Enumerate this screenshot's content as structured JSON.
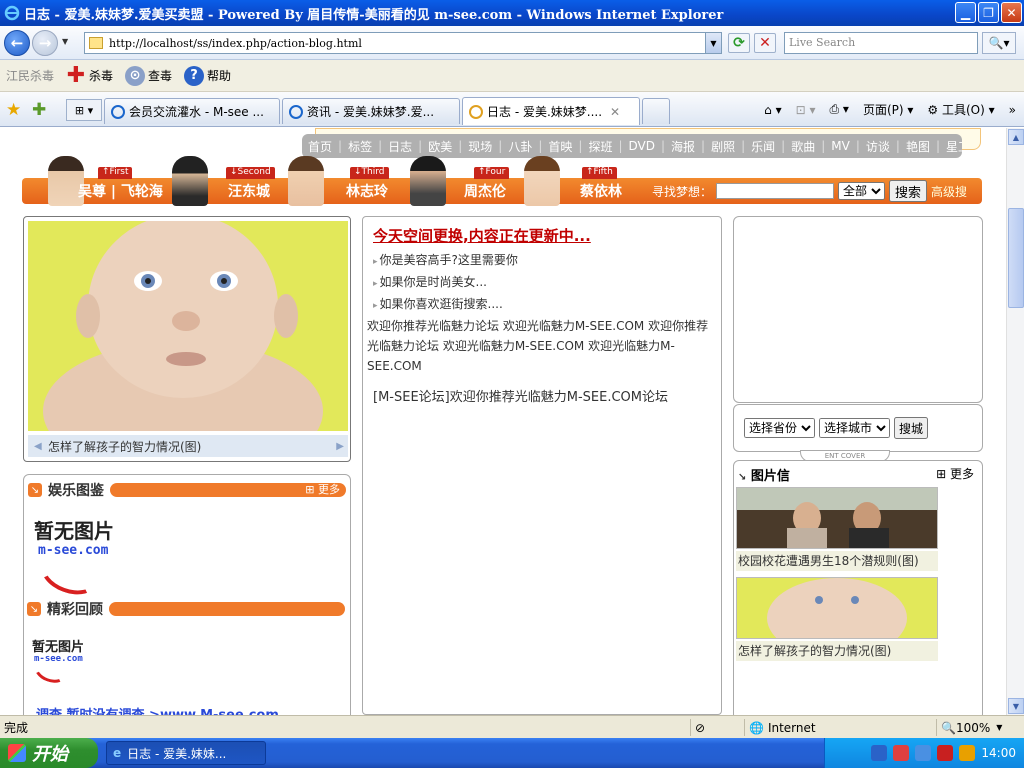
{
  "window": {
    "title": "日志 - 爱美.妹妹梦.爱美买卖盟 - Powered By 眉目传情-美丽看的见 m-see.com - Windows Internet Explorer"
  },
  "address_bar": {
    "url": "http://localhost/ss/index.php/action-blog.html",
    "search_placeholder": "Live Search"
  },
  "personal_toolbar": {
    "brand": "江民杀毒",
    "items": [
      "杀毒",
      "查毒",
      "帮助"
    ]
  },
  "tabs": [
    {
      "label": "会员交流灌水 - M-see ...",
      "active": false
    },
    {
      "label": "资讯 - 爱美.妹妹梦.爱...",
      "active": false
    },
    {
      "label": "日志 - 爱美.妹妹梦....",
      "active": true
    }
  ],
  "ie_tools": {
    "page": "页面(P)",
    "tools": "工具(O)"
  },
  "site": {
    "top_nav": [
      "首页",
      "标签",
      "日志",
      "欧美",
      "现场",
      "八卦",
      "首映",
      "探班",
      "DVD",
      "海报",
      "剧照",
      "乐闻",
      "歌曲",
      "MV",
      "访谈",
      "艳图",
      "星工场"
    ],
    "stars": [
      {
        "tag": "↑First",
        "name": "吴尊 | 飞轮海"
      },
      {
        "tag": "↓Second",
        "name": "汪东城"
      },
      {
        "tag": "↓Third",
        "name": "林志玲"
      },
      {
        "tag": "↑Four",
        "name": "周杰伦"
      },
      {
        "tag": "↑Fifth",
        "name": "蔡依林"
      }
    ],
    "search": {
      "label": "寻找梦想：",
      "select": "全部",
      "button": "搜索",
      "advanced": "高级搜"
    },
    "feature": {
      "caption": "怎样了解孩子的智力情况(图)"
    },
    "sections": {
      "ent": {
        "title": "娱乐图鉴",
        "more": "更多"
      },
      "review": {
        "title": "精彩回顾"
      }
    },
    "nopic": {
      "text": "暂无图片",
      "url": "m-see.com"
    },
    "bottom_link": "调查    暂时没有调查    >www.M-see.com",
    "middle": {
      "headline": "今天空间更换,内容正在更新中...",
      "items": [
        "你是美容高手?这里需要你",
        "如果你是时尚美女...",
        "如果你喜欢逛街搜索...."
      ],
      "paragraph": "欢迎你推荐光临魅力论坛 欢迎光临魅力M-SEE.COM 欢迎你推荐光临魅力论坛 欢迎光临魅力M-SEE.COM 欢迎光临魅力M-SEE.COM",
      "note": "[M-SEE论坛]欢迎你推荐光临魅力M-SEE.COM论坛"
    },
    "region": {
      "province": "选择省份",
      "city": "选择城市",
      "button": "搜城"
    },
    "ent_cover": "ENT COVER",
    "pic_news": {
      "title": "图片信",
      "more": "更多",
      "items": [
        {
          "caption": "校园校花遭遇男生18个潜规则(图)"
        },
        {
          "caption": "怎样了解孩子的智力情况(图)"
        }
      ]
    }
  },
  "status_bar": {
    "text": "完成",
    "zone": "Internet",
    "zoom": "100%"
  },
  "taskbar": {
    "start": "开始",
    "task": "日志 - 爱美.妹妹...",
    "clock": "14:00"
  }
}
